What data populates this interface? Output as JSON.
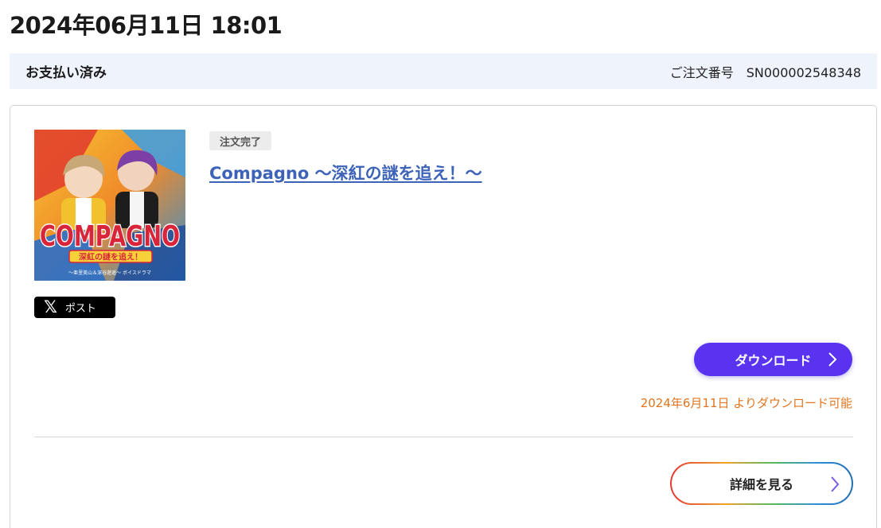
{
  "order": {
    "datetime": "2024年06月11日 18:01",
    "status": "お支払い済み",
    "order_number_label": "ご注文番号",
    "order_number": "SN000002548348"
  },
  "item": {
    "badge": "注文完了",
    "title": "Compagno 〜深紅の謎を追え！〜",
    "cover_logo": "COMPAGNO",
    "cover_subtitle": "深紅の謎を追え！",
    "cover_caption": "〜亜里美山＆深谷遊遥〜 ボイスドラマ",
    "post_label": "ポスト",
    "download_label": "ダウンロード",
    "download_note": "2024年6月11日 よりダウンロード可能",
    "detail_label": "詳細を見る"
  },
  "colors": {
    "accent_purple": "#5933f0",
    "link_blue": "#3d63b8",
    "note_orange": "#e2751f",
    "status_bg": "#eef3fc"
  },
  "icons": {
    "post": "x-logo-icon",
    "download_chevron": "chevron-right-icon",
    "detail_chevron": "chevron-right-icon"
  }
}
